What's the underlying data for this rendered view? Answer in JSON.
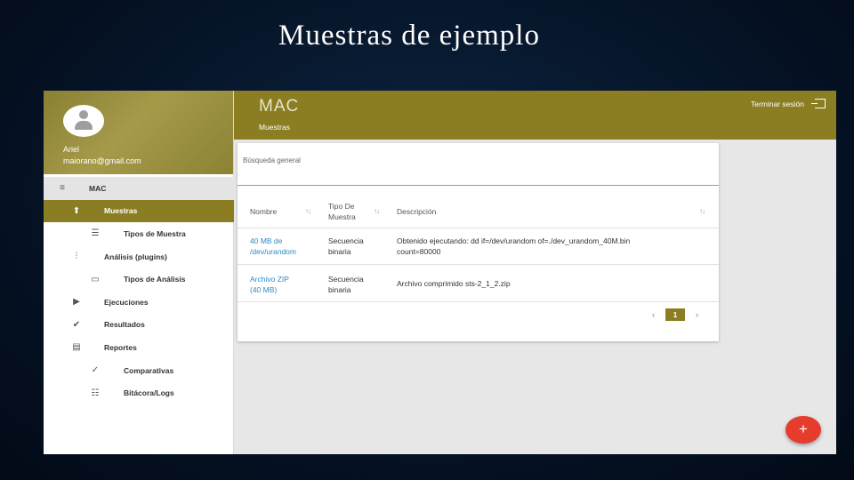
{
  "slide": {
    "title": "Muestras de ejemplo"
  },
  "user": {
    "name": "Ariel",
    "email": "maiorano@gmail.com"
  },
  "sidebar": {
    "items": [
      {
        "label": "MAC",
        "icon": "menu-icon"
      },
      {
        "label": "Muestras",
        "icon": "upload-icon"
      },
      {
        "label": "Tipos de Muestra",
        "icon": "list-icon"
      },
      {
        "label": "Análisis (plugins)",
        "icon": "equalizer-icon"
      },
      {
        "label": "Tipos de Análisis",
        "icon": "video-label-icon"
      },
      {
        "label": "Ejecuciones",
        "icon": "play-icon"
      },
      {
        "label": "Resultados",
        "icon": "check-circle-icon"
      },
      {
        "label": "Reportes",
        "icon": "library-books-icon"
      },
      {
        "label": "Comparativas",
        "icon": "compare-icon"
      },
      {
        "label": "Bitácora/Logs",
        "icon": "notes-icon"
      }
    ]
  },
  "header": {
    "app_name": "MAC",
    "breadcrumb": "Muestras",
    "logout_label": "Terminar sesión"
  },
  "search": {
    "placeholder": "Búsqueda general"
  },
  "table": {
    "headers": [
      "Nombre",
      "Tipo De\nMuestra",
      "Descripción"
    ],
    "rows": [
      {
        "name": "40 MB de\n/dev/urandom",
        "type": "Secuencia\nbinaria",
        "description": "Obtenido ejecutando: dd if=/dev/urandom of=./dev_urandom_40M.bin\ncount=80000"
      },
      {
        "name": "Archivo ZIP\n(40 MB)",
        "type": "Secuencia\nbinaria",
        "description": "Archivo comprimido sts-2_1_2.zip"
      }
    ]
  },
  "pagination": {
    "prev": "‹",
    "current": "1",
    "next": "›"
  },
  "fab": {
    "label": "+"
  },
  "colors": {
    "accent": "#8a7d22",
    "link": "#2a8ac9",
    "fab": "#e63c2e",
    "background": "#061428"
  }
}
